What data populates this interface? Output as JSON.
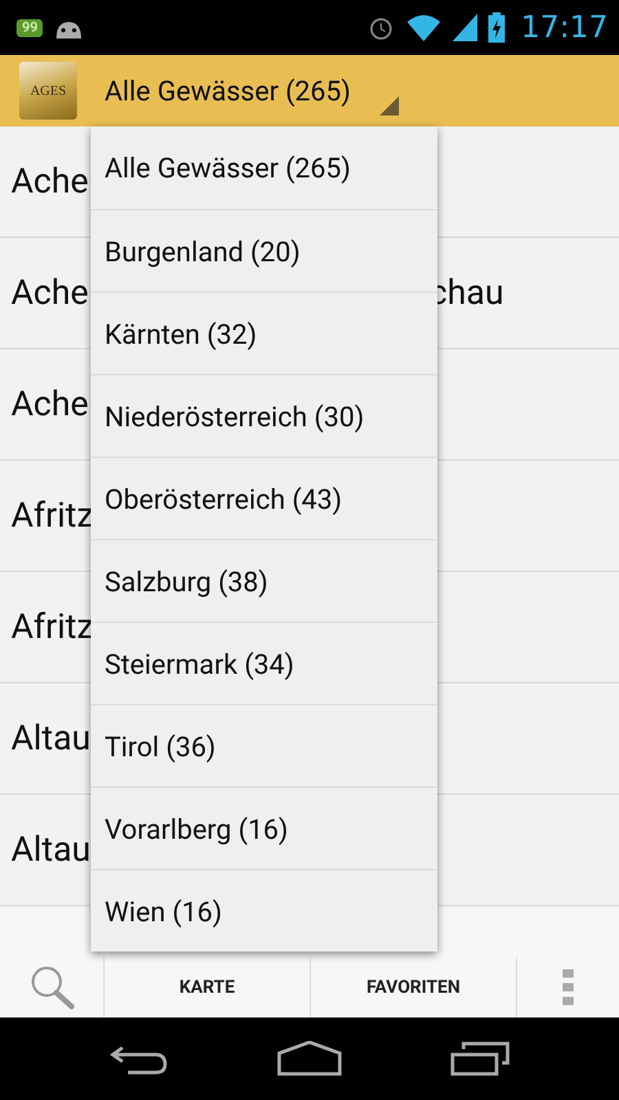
{
  "status_bar": {
    "badge": "99",
    "time": "17:17"
  },
  "action_bar": {
    "logo_text": "AGES",
    "spinner": "Alle Gewässer (265)"
  },
  "list": [
    {
      "text": "Ache"
    },
    {
      "text": "Ache",
      "tail": "chau"
    },
    {
      "text": "Ache"
    },
    {
      "text": "Afritz"
    },
    {
      "text": "Afritz"
    },
    {
      "text": "Altau"
    },
    {
      "text": "Altau"
    }
  ],
  "dropdown": [
    "Alle Gewässer (265)",
    "Burgenland (20)",
    "Kärnten (32)",
    "Niederösterreich (30)",
    "Oberösterreich (43)",
    "Salzburg (38)",
    "Steiermark (34)",
    "Tirol (36)",
    "Vorarlberg (16)",
    "Wien (16)"
  ],
  "bottom_bar": {
    "tabs": [
      "KARTE",
      "FAVORITEN"
    ]
  }
}
